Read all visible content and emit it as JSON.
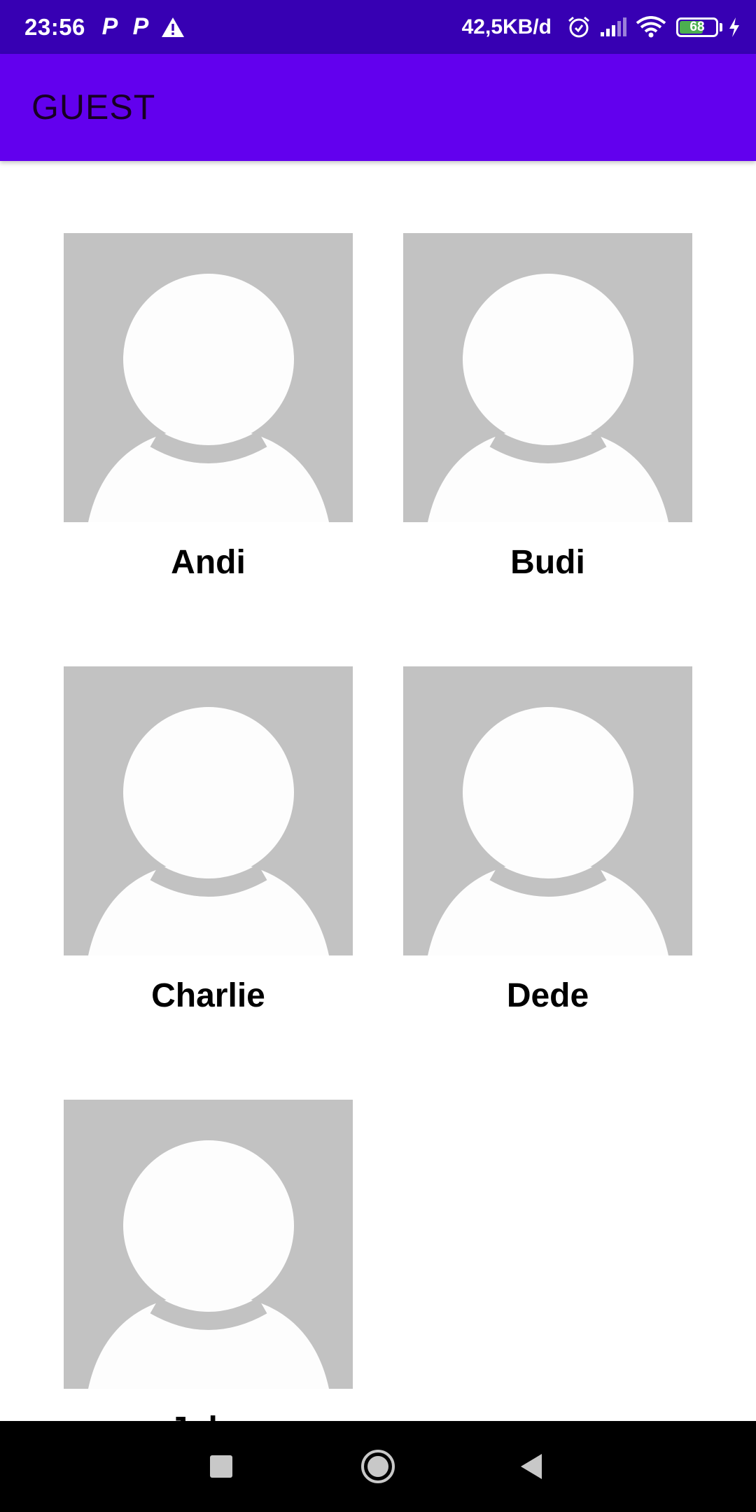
{
  "status_bar": {
    "time": "23:56",
    "notifications": [
      "P",
      "P",
      "warning-icon"
    ],
    "network_speed": "42,5KB/d",
    "battery_level": "68",
    "battery_fraction": 0.68,
    "icons": [
      "alarm-icon",
      "signal-icon",
      "wifi-icon",
      "battery-icon",
      "charging-icon"
    ]
  },
  "app_bar": {
    "title": "GUEST"
  },
  "guests": [
    {
      "name": "Andi"
    },
    {
      "name": "Budi"
    },
    {
      "name": "Charlie"
    },
    {
      "name": "Dede"
    },
    {
      "name": "Joko"
    }
  ],
  "navigation_bar": {
    "buttons": [
      "recents-button",
      "home-button",
      "back-button"
    ]
  },
  "colors": {
    "status_bar": "#3700b3",
    "app_bar": "#6200ee",
    "avatar_background": "#c2c2c2",
    "avatar_figure": "#fdfdfd",
    "battery_fill": "#4caf50"
  }
}
